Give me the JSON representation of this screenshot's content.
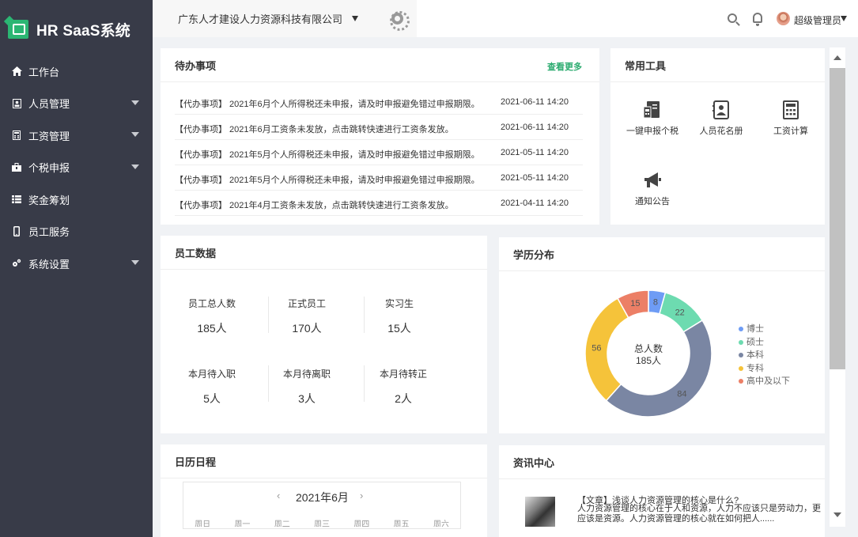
{
  "app": {
    "title": "HR SaaS系统"
  },
  "nav": [
    {
      "label": "工作台",
      "icon": "home-icon",
      "caret": false
    },
    {
      "label": "人员管理",
      "icon": "id-card-icon",
      "caret": true
    },
    {
      "label": "工资管理",
      "icon": "calculator-icon",
      "caret": true
    },
    {
      "label": "个税申报",
      "icon": "briefcase-icon",
      "caret": true
    },
    {
      "label": "奖金筹划",
      "icon": "list-icon",
      "caret": false
    },
    {
      "label": "员工服务",
      "icon": "mobile-icon",
      "caret": false
    },
    {
      "label": "系统设置",
      "icon": "gears-icon",
      "caret": true
    }
  ],
  "header": {
    "company": "广东人才建设人力资源科技有限公司",
    "username": "超级管理员"
  },
  "todo": {
    "title": "待办事项",
    "more": "查看更多",
    "items": [
      {
        "text": "【代办事项】 2021年6月个人所得税还未申报，请及时申报避免错过申报期限。",
        "time": "2021-06-11 14:20"
      },
      {
        "text": "【代办事项】 2021年6月工资条未发放，点击跳转快速进行工资条发放。",
        "time": "2021-06-11 14:20"
      },
      {
        "text": "【代办事项】 2021年5月个人所得税还未申报，请及时申报避免错过申报期限。",
        "time": "2021-05-11 14:20"
      },
      {
        "text": "【代办事项】 2021年5月个人所得税还未申报，请及时申报避免错过申报期限。",
        "time": "2021-05-11 14:20"
      },
      {
        "text": "【代办事项】 2021年4月工资条未发放，点击跳转快速进行工资条发放。",
        "time": "2021-04-11 14:20"
      }
    ]
  },
  "tools": {
    "title": "常用工具",
    "items": [
      {
        "label": "一键申报个税",
        "icon": "file-tax-icon"
      },
      {
        "label": "人员花名册",
        "icon": "roster-icon"
      },
      {
        "label": "工资计算",
        "icon": "calculator-icon"
      },
      {
        "label": "通知公告",
        "icon": "megaphone-icon"
      }
    ]
  },
  "employee": {
    "title": "员工数据",
    "stats": [
      {
        "label": "员工总人数",
        "value": "185人"
      },
      {
        "label": "正式员工",
        "value": "170人"
      },
      {
        "label": "实习生",
        "value": "15人"
      },
      {
        "label": "本月待入职",
        "value": "5人"
      },
      {
        "label": "本月待离职",
        "value": "3人"
      },
      {
        "label": "本月待转正",
        "value": "2人"
      }
    ]
  },
  "education": {
    "title": "学历分布",
    "center_label": "总人数",
    "center_value": "185人"
  },
  "chart_data": {
    "type": "pie",
    "categories": [
      "博士",
      "硕士",
      "本科",
      "专科",
      "高中及以下"
    ],
    "values": [
      8,
      22,
      84,
      56,
      15
    ],
    "colors": [
      "#6e9cf5",
      "#6ddbb0",
      "#7a86a3",
      "#f5c33a",
      "#ec7f66"
    ],
    "legend_position": "right",
    "donut": true
  },
  "calendar": {
    "title": "日历日程",
    "month": "2021年6月",
    "weekdays": [
      "周日",
      "周一",
      "周二",
      "周三",
      "周四",
      "周五",
      "周六"
    ]
  },
  "news": {
    "title": "资讯中心",
    "item_title": "【文章】浅谈人力资源管理的核心是什么?",
    "item_body": "人力资源管理的核心在于人和资源，人力不应该只是劳动力，更应该是资源。人力资源管理的核心就在如何把人......"
  }
}
